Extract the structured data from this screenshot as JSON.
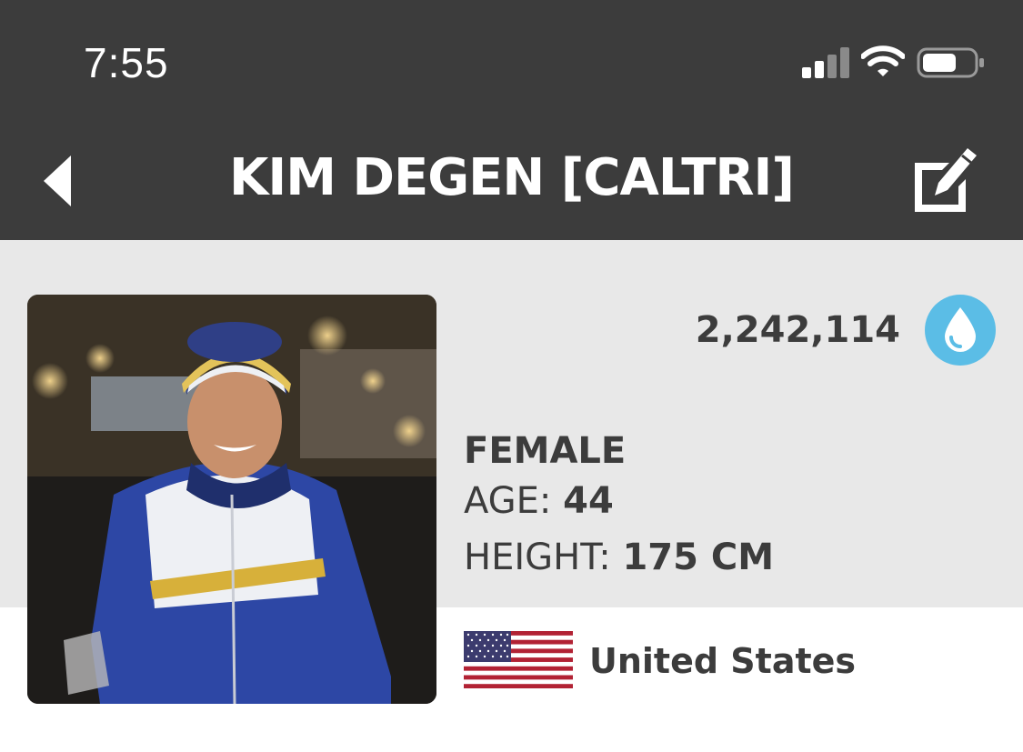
{
  "status_bar": {
    "time": "7:55",
    "signal_icon": "cellular-signal-icon",
    "wifi_icon": "wifi-icon",
    "battery_icon": "battery-icon"
  },
  "nav": {
    "title": "KIM DEGEN [CALTRI]",
    "back_icon": "back-arrow-icon",
    "edit_icon": "edit-icon"
  },
  "profile": {
    "points": "2,242,114",
    "badge_icon": "water-drop-icon",
    "gender": "FEMALE",
    "age_label": "AGE:",
    "age_value": "44",
    "height_label": "HEIGHT:",
    "height_value": "175 CM",
    "country": "United States",
    "flag_icon": "us-flag-icon"
  },
  "colors": {
    "header_bg": "#3c3c3c",
    "profile_bg": "#e8e8e8",
    "text": "#3c3c3c",
    "accent_blue": "#5bbde6"
  }
}
